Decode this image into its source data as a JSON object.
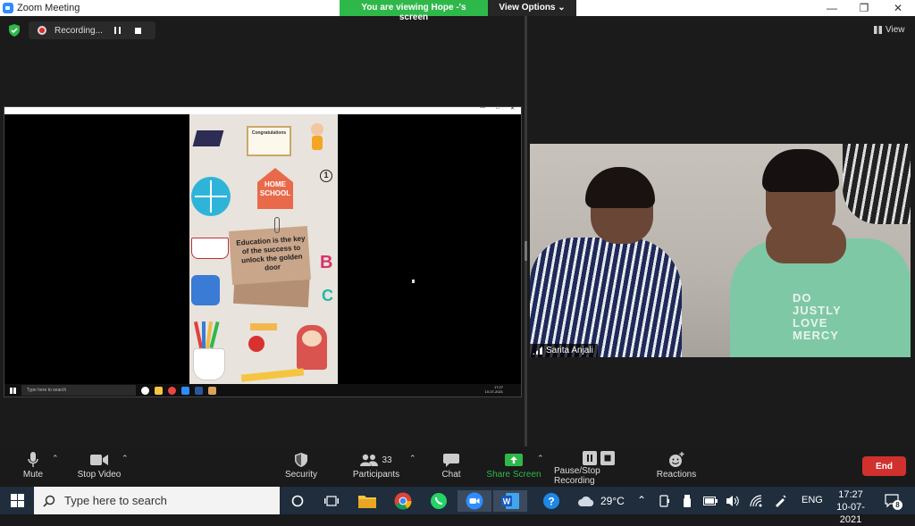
{
  "window": {
    "title": "Zoom Meeting"
  },
  "banner": {
    "viewing": "You are viewing Hope -'s screen",
    "view_options": "View Options ⌄"
  },
  "recording": {
    "label": "Recording..."
  },
  "view_button": {
    "label": "View"
  },
  "shared_screen": {
    "certificate_text": "Congratulations",
    "number_badge": "1",
    "home_school": "HOME\nSCHOOL",
    "note_text": "Education is the key of the success to unlock the golden door",
    "letter_b": "B",
    "letter_c": "C",
    "taskbar_search": "Type here to search",
    "taskbar_time": "17:27",
    "taskbar_date": "10-07-2021"
  },
  "video": {
    "participant_name": "Sarita Anjali",
    "shirt_text": "DO\nJUSTLY\nLOVE\nMERCY"
  },
  "toolbar": {
    "mute": "Mute",
    "stop_video": "Stop Video",
    "security": "Security",
    "participants": "Participants",
    "participants_count": "33",
    "chat": "Chat",
    "share_screen": "Share Screen",
    "pause_stop_recording": "Pause/Stop Recording",
    "reactions": "Reactions",
    "end": "End",
    "share_color": "#2fb84a",
    "end_color": "#d0312d"
  },
  "taskbar": {
    "search_placeholder": "Type here to search",
    "weather": "29°C",
    "language": "ENG",
    "time": "17:27",
    "date": "10-07-2021",
    "notifications": "8"
  }
}
